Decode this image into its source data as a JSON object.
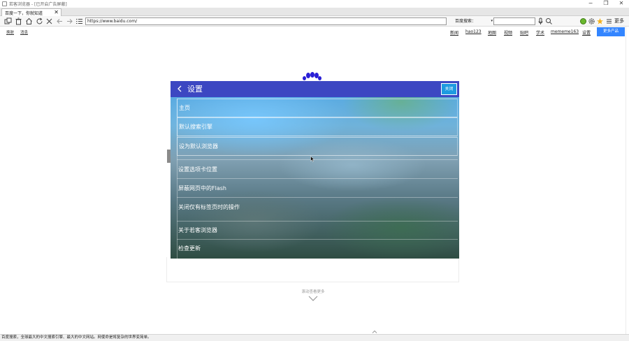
{
  "window": {
    "title": "若客浏览器 - [已开启广告屏蔽]",
    "controls": {
      "minimize": "−",
      "maximize": "❐",
      "close": "✕"
    }
  },
  "tabs": [
    {
      "label": "百度一下，你就知道",
      "active": true,
      "close": "✕"
    }
  ],
  "toolbar": {
    "address": "https://www.baidu.com/",
    "search_engine": "百度搜索：",
    "search_engine_caret": "▾",
    "more_label": "更多",
    "icons": [
      "new-window-icon",
      "trash-icon",
      "home-icon",
      "refresh-icon",
      "stop-icon",
      "back-icon",
      "forward-icon",
      "bookmarks-icon",
      "microphone-icon",
      "search-icon",
      "green-ball-icon",
      "gear-icon",
      "star-icon",
      "menu-icon"
    ]
  },
  "baidu_nav": {
    "left": [
      "换肤",
      "消息"
    ],
    "right": [
      "新闻",
      "hao123",
      "地图",
      "视频",
      "贴吧",
      "学术",
      "mememe163",
      "设置"
    ],
    "more_products": "更多产品"
  },
  "settings_dialog": {
    "title": "设置",
    "close_label": "关闭",
    "items": [
      {
        "label": "主页"
      },
      {
        "label": "默认搜索引擎"
      },
      {
        "label": "设为默认浏览器"
      },
      {
        "label": "设置选项卡位置"
      },
      {
        "label": "屏蔽网页中的Flash"
      },
      {
        "label": "关闭仅有标签页时的操作"
      },
      {
        "label": "关于若客浏览器"
      },
      {
        "label": "检查更新"
      }
    ]
  },
  "page": {
    "see_more": "滚动查看更多"
  },
  "statusbar": {
    "text": "百度搜索，全球最大的中文搜索引擎、最大的中文网站。网使命是将复杂的世界变简单。"
  },
  "colors": {
    "dialog_header": "#3c47c2",
    "close_button": "#1e9be0",
    "more_products": "#3385ff",
    "baidu_paw": "#2a1fd6"
  }
}
